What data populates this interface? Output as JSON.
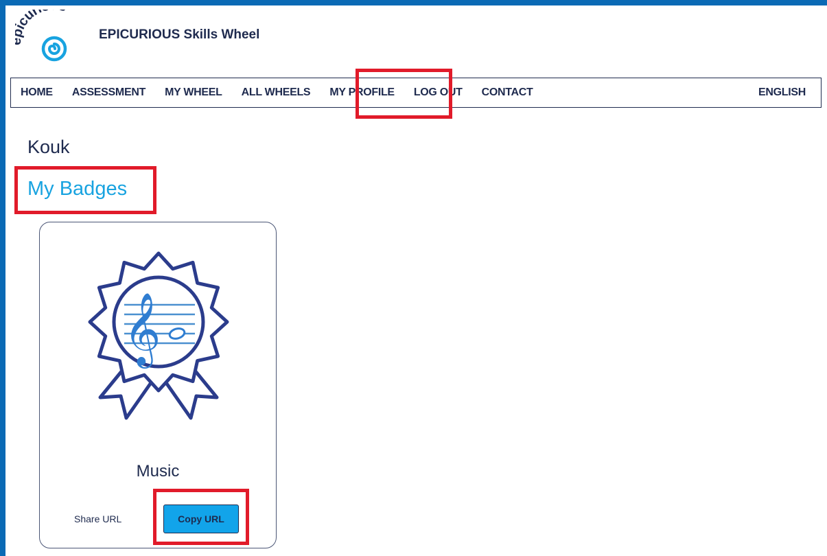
{
  "app": {
    "logo_text": "epicurious",
    "title": "EPICURIOUS Skills Wheel"
  },
  "nav": {
    "home": "HOME",
    "assessment": "ASSESSMENT",
    "my_wheel": "MY WHEEL",
    "all_wheels": "ALL WHEELS",
    "my_profile": "MY PROFILE",
    "log_out": "LOG OUT",
    "contact": "CONTACT",
    "language": "ENGLISH"
  },
  "profile": {
    "user_name": "Kouk",
    "section_title": "My Badges"
  },
  "badges": [
    {
      "name": "Music",
      "share_label": "Share URL",
      "copy_button": "Copy URL",
      "icon": "music-badge-icon"
    }
  ],
  "colors": {
    "frame": "#0a6ab5",
    "navy": "#1e2a4e",
    "accent": "#18a3e0",
    "button": "#12a4ea",
    "highlight": "#e11b2a"
  }
}
